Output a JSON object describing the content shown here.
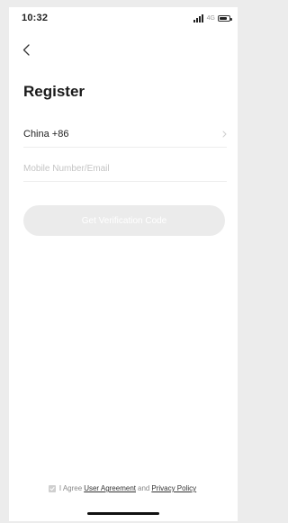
{
  "status_bar": {
    "time": "10:32",
    "network": "4G",
    "icons": [
      "signal-icon",
      "battery-icon"
    ]
  },
  "nav": {
    "back_icon": "chevron-left-icon"
  },
  "page": {
    "title": "Register"
  },
  "form": {
    "country": {
      "label": "China +86",
      "icon": "chevron-right-icon"
    },
    "account": {
      "value": "",
      "placeholder": "Mobile Number/Email"
    },
    "submit_label": "Get Verification Code"
  },
  "agreement": {
    "checked": true,
    "prefix": "I Agree",
    "user_agreement": "User Agreement",
    "conjunction": "and",
    "privacy_policy": "Privacy Policy"
  },
  "colors": {
    "button_disabled_bg": "#ebebeb",
    "button_text": "#ffffff",
    "divider": "#ededed",
    "title": "#1a1a1a"
  }
}
